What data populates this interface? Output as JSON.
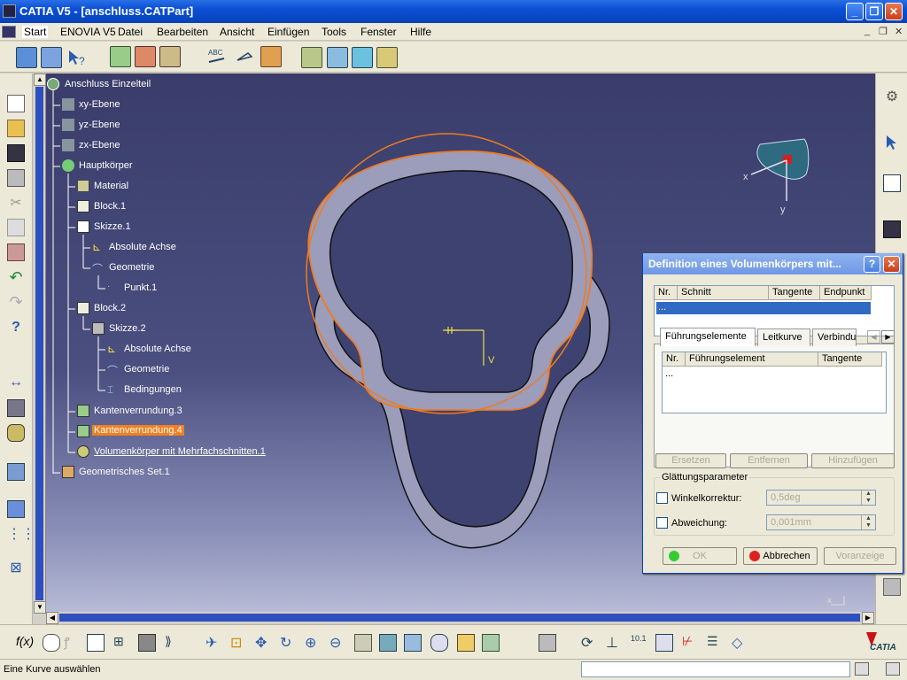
{
  "window": {
    "title": "CATIA V5 - [anschluss.CATPart]",
    "controls": {
      "minimize": "_",
      "restore": "❐",
      "close": "✕"
    }
  },
  "menu": {
    "items": [
      "Start",
      "ENOVIA V5",
      "Datei",
      "Bearbeiten",
      "Ansicht",
      "Einfügen",
      "Tools",
      "Fenster",
      "Hilfe"
    ],
    "doc_controls": [
      "_",
      "❐",
      "✕"
    ]
  },
  "tree": {
    "root": "Anschluss Einzelteil",
    "nodes": [
      {
        "label": "xy-Ebene"
      },
      {
        "label": "yz-Ebene"
      },
      {
        "label": "zx-Ebene"
      },
      {
        "label": "Hauptkörper"
      },
      {
        "label": "Material"
      },
      {
        "label": "Block.1"
      },
      {
        "label": "Skizze.1"
      },
      {
        "label": "Absolute Achse"
      },
      {
        "label": "Geometrie"
      },
      {
        "label": "Punkt.1"
      },
      {
        "label": "Block.2"
      },
      {
        "label": "Skizze.2"
      },
      {
        "label": "Absolute Achse"
      },
      {
        "label": "Geometrie"
      },
      {
        "label": "Bedingungen"
      },
      {
        "label": "Kantenverrundung.3"
      },
      {
        "label": "Kantenverrundung.4",
        "highlight": true
      },
      {
        "label": "Volumenkörper mit Mehrfachschnitten.1",
        "underline": true
      },
      {
        "label": "Geometrisches Set.1"
      }
    ]
  },
  "viewport": {
    "axis_labels": {
      "x": "x",
      "y": "y",
      "sketch_v": "V",
      "compass_x": "x",
      "compass_y": "y"
    },
    "colors": {
      "highlight_orange": "#f07a20",
      "part_fill": "#9b9dbb",
      "sketch_yellow": "#e8e04a"
    }
  },
  "dialog": {
    "title": "Definition eines Volumenkörpers mit...",
    "help": "?",
    "close": "✕",
    "section_table": {
      "headers": [
        "Nr.",
        "Schnitt",
        "Tangente",
        "Endpunkt"
      ],
      "rows": [
        [
          "...",
          "",
          "",
          ""
        ]
      ]
    },
    "tabs": [
      "Führungselemente",
      "Leitkurve",
      "Verbindu"
    ],
    "tab_arrows": [
      "◀",
      "▶"
    ],
    "guide_table": {
      "headers": [
        "Nr.",
        "Führungselement",
        "Tangente"
      ],
      "rows": [
        [
          "...",
          "",
          ""
        ]
      ]
    },
    "buttons": {
      "replace": "Ersetzen",
      "remove": "Entfernen",
      "add": "Hinzufügen"
    },
    "smoothing": {
      "group_label": "Glättungsparameter",
      "angle_label": "Winkelkorrektur:",
      "angle_value": "0,5deg",
      "deviation_label": "Abweichung:",
      "deviation_value": "0,001mm"
    },
    "footer": {
      "ok": "OK",
      "cancel": "Abbrechen",
      "preview": "Voranzeige"
    }
  },
  "status": {
    "message": "Eine Kurve auswählen"
  },
  "brand": {
    "logo_text": "CATIA"
  }
}
